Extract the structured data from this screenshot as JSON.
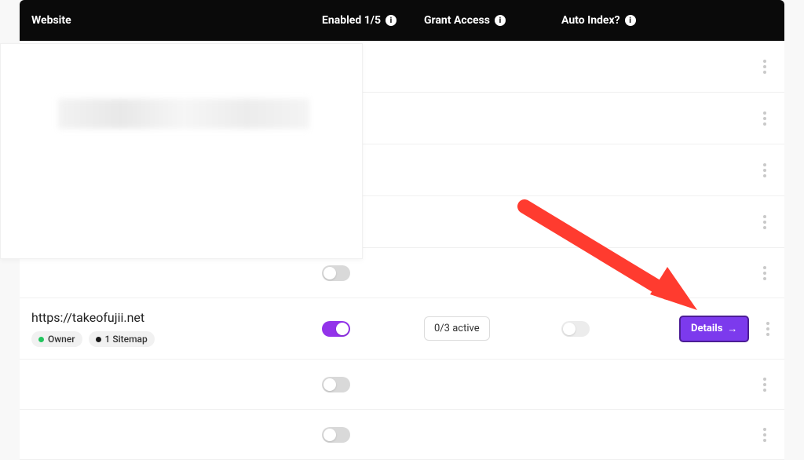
{
  "header": {
    "website": "Website",
    "enabled": "Enabled 1/5",
    "grant_access": "Grant Access",
    "auto_index": "Auto Index?"
  },
  "rows": {
    "r6": {
      "url": "https://takeofujii.net",
      "owner_label": "Owner",
      "sitemap_label": "1 Sitemap",
      "grant_text": "0/3 active",
      "details_label": "Details"
    }
  },
  "icons": {
    "info": "i",
    "arrow_right": "→"
  }
}
